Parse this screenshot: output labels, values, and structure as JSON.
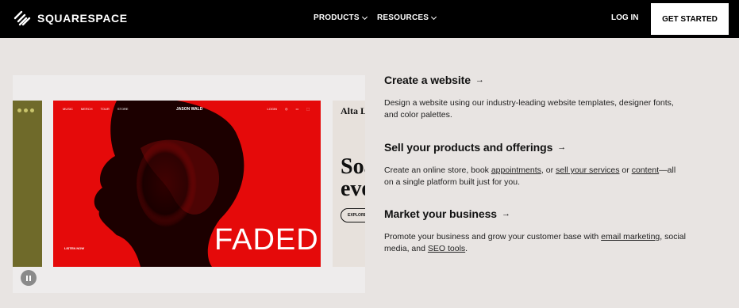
{
  "nav": {
    "logo_text": "SQUARESPACE",
    "products": "PRODUCTS",
    "resources": "RESOURCES",
    "login": "LOG IN",
    "cta": "GET STARTED"
  },
  "carousel": {
    "main_slide": {
      "site_name": "JASON WALD",
      "nav_items": [
        "MUSIC",
        "MERCH",
        "TOUR",
        "STORE"
      ],
      "right_items": [
        "LOGIN",
        "◎",
        "▭",
        "⬚"
      ],
      "headline": "FADED",
      "listen": "LISTEN NOW"
    },
    "right_slide": {
      "title": "Alta Lo",
      "headline": "Soa\neve",
      "button": "EXPLORE"
    },
    "pause_label": "pause"
  },
  "features": [
    {
      "title": "Create a website",
      "arrow": "→",
      "text_parts": [
        {
          "t": "Design a website using our industry-leading website templates, designer fonts, and color palettes.",
          "link": false
        }
      ]
    },
    {
      "title": "Sell your products and offerings",
      "arrow": "→",
      "text_parts": [
        {
          "t": "Create an online store, book ",
          "link": false
        },
        {
          "t": "appointments",
          "link": true
        },
        {
          "t": ", or ",
          "link": false
        },
        {
          "t": "sell your services",
          "link": true
        },
        {
          "t": " or ",
          "link": false
        },
        {
          "t": "content",
          "link": true
        },
        {
          "t": "—all on a single platform built just for you.",
          "link": false
        }
      ]
    },
    {
      "title": "Market your business",
      "arrow": "→",
      "text_parts": [
        {
          "t": "Promote your business and grow your customer base with ",
          "link": false
        },
        {
          "t": "email marketing",
          "link": true
        },
        {
          "t": ", social media, and ",
          "link": false
        },
        {
          "t": "SEO tools",
          "link": true
        },
        {
          "t": ".",
          "link": false
        }
      ]
    }
  ],
  "colors": {
    "nav_bg": "#000000",
    "page_bg": "#e8e4e2",
    "slide_red": "#e50a0a",
    "slide_olive": "#6f6a2a"
  }
}
